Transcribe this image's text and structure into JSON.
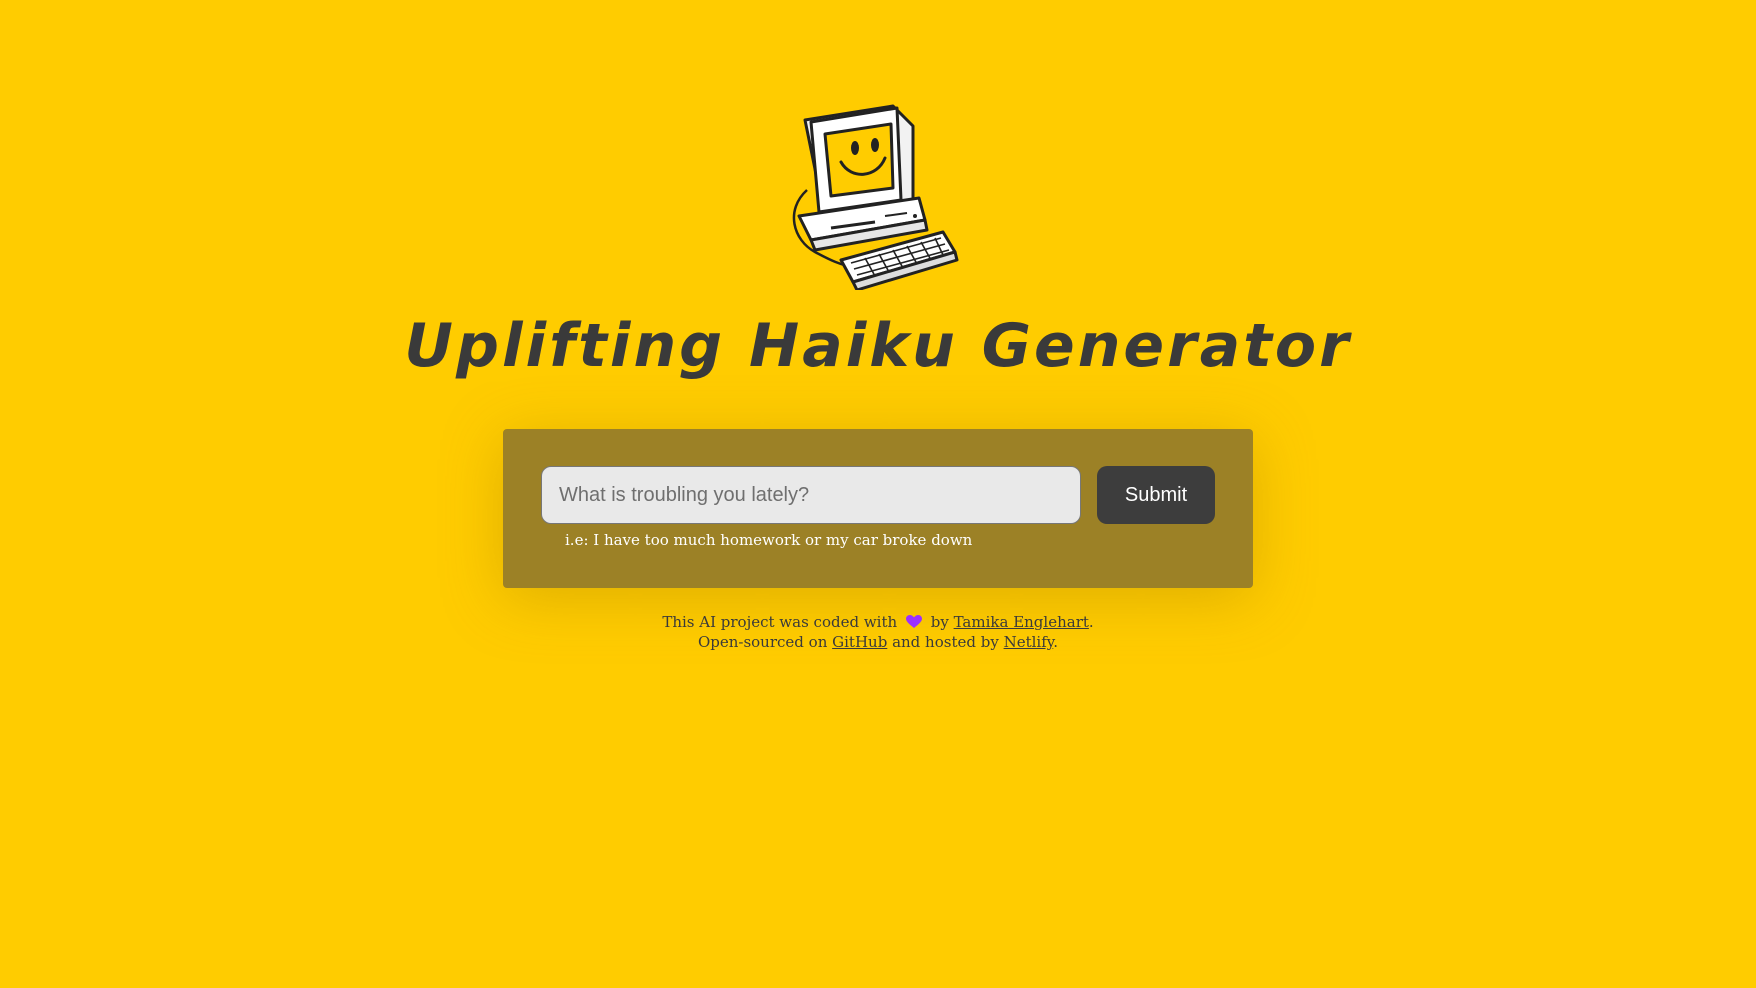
{
  "header": {
    "logo_icon": "retro-computer-smiley-icon",
    "title": "Uplifting Haiku Generator"
  },
  "form": {
    "placeholder": "What is troubling you lately?",
    "value": "",
    "submit_label": "Submit",
    "hint": "i.e: I have too much homework or my car broke down"
  },
  "footer": {
    "line1_prefix": "This AI project was coded with",
    "heart_icon": "purple-heart-icon",
    "line1_by": "by",
    "author_link": "Tamika Englehart",
    "line1_suffix": ".",
    "line2_prefix": "Open-sourced on",
    "github_link": "GitHub",
    "line2_mid": "and hosted by",
    "netlify_link": "Netlify",
    "line2_suffix": "."
  },
  "colors": {
    "background": "#ffcc00",
    "panel": "#9c8126",
    "button": "#3d3d3d",
    "heart": "#9b30ff"
  }
}
